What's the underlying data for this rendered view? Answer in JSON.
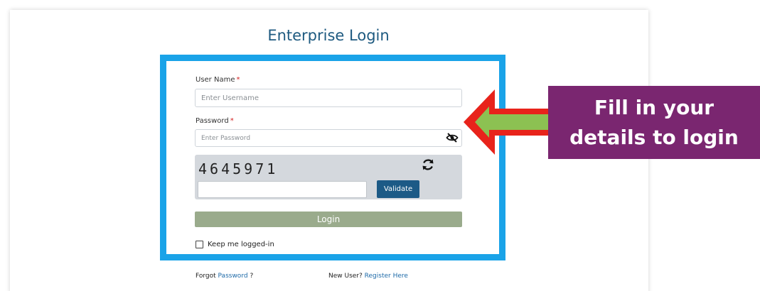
{
  "page": {
    "title": "Enterprise Login"
  },
  "form": {
    "username_label": "User Name",
    "username_placeholder": "Enter Username",
    "password_label": "Password",
    "password_placeholder": "Enter Password",
    "required_marker": "*",
    "captcha_code": "4645971",
    "captcha_value": "",
    "validate_label": "Validate",
    "login_label": "Login",
    "keep_logged_in_label": "Keep me logged-in",
    "keep_logged_in_checked": false
  },
  "footer": {
    "forgot_prefix": "Forgot",
    "forgot_link": "Password",
    "forgot_suffix": "?",
    "new_user_prefix": "New User?",
    "register_link": "Register Here"
  },
  "annotation": {
    "callout_line1": "Fill in your",
    "callout_line2": "details to login"
  },
  "icons": {
    "password_toggle": "eye-slash-icon",
    "captcha_refresh": "refresh-icon",
    "callout_pointer": "left-arrow-icon"
  },
  "colors": {
    "highlight_border": "#1aa3e8",
    "title_text": "#1e5a80",
    "validate_button": "#1c5a86",
    "login_button": "#9aab8c",
    "callout_background": "#7a2670",
    "arrow_outline": "#e8231b",
    "arrow_fill": "#8cc152"
  }
}
